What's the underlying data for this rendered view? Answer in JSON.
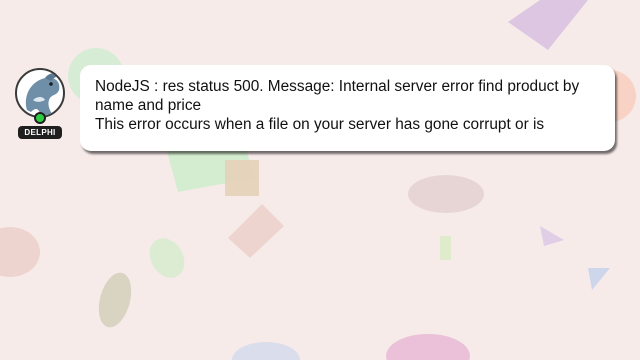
{
  "user": {
    "name": "DELPHI",
    "avatar_icon": "dolphin-icon",
    "status_color": "#2ecc40"
  },
  "message": {
    "line1": "NodeJS : res status 500. Message: Internal server error find product by",
    "line2": "name and price",
    "line3": "This error occurs when a file on your server has gone corrupt or is"
  },
  "colors": {
    "background": "#f7ebea",
    "bubble": "#ffffff",
    "text": "#111111"
  }
}
